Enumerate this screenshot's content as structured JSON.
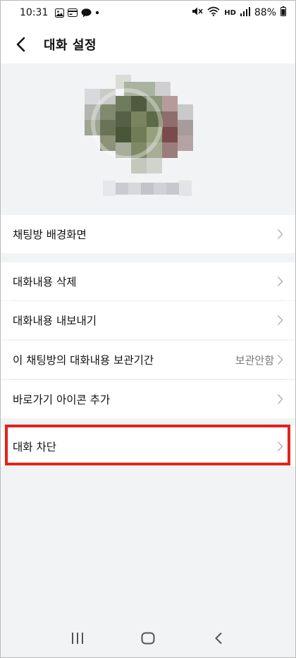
{
  "status_bar": {
    "time": "10:31",
    "network": "HD",
    "battery": "88%"
  },
  "header": {
    "title": "대화 설정",
    "back_icon": "chevron-left-icon"
  },
  "settings": {
    "background": {
      "label": "채팅방 배경화면"
    },
    "delete": {
      "label": "대화내용 삭제"
    },
    "export": {
      "label": "대화내용 내보내기"
    },
    "retention": {
      "label": "이 채팅방의 대화내용 보관기간",
      "value": "보관안함"
    },
    "shortcut": {
      "label": "바로가기 아이콘 추가"
    },
    "block": {
      "label": "대화 차단"
    }
  },
  "colors": {
    "highlight": "#e2231a",
    "background": "#f2f3f5",
    "row": "#ffffff"
  },
  "nav": {
    "recent_icon": "recent-apps-icon",
    "home_icon": "home-icon",
    "back_icon": "back-icon"
  }
}
